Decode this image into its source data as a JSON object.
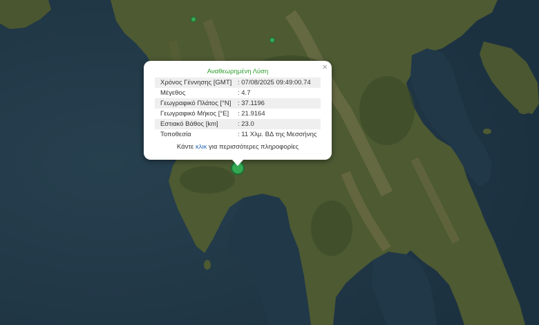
{
  "map": {
    "colors": {
      "sea": "#22394a",
      "land": "#4f5d33",
      "mountain": "#6b6a44",
      "forest": "#3f4f2a"
    }
  },
  "markers": [
    {
      "name": "earthquake-marker-main",
      "color": "#34a853",
      "magnitude": 4.7
    },
    {
      "name": "earthquake-marker-small-1",
      "color": "#34a853"
    },
    {
      "name": "earthquake-marker-small-2",
      "color": "#34a853"
    }
  ],
  "popup": {
    "close": "×",
    "title": "Αναθεωρημένη Λύση",
    "rows": [
      {
        "label": "Χρόνος Γέννησης [GMT]",
        "value": ": 07/08/2025 09:49:00.74"
      },
      {
        "label": "Μέγεθος",
        "value": ": 4.7"
      },
      {
        "label": "Γεωγραφικό Πλάτος [°N]",
        "value": ": 37.1196"
      },
      {
        "label": "Γεωγραφικό Μήκος [°E]",
        "value": ": 21.9164"
      },
      {
        "label": "Εστιακό Βάθος [km]",
        "value": ": 23.0"
      },
      {
        "label": "Τοποθεσία",
        "value": ": 11 Χλμ. ΒΔ της Μεσσήνης"
      }
    ],
    "footer_before": "Κάντε ",
    "footer_link": "κλικ",
    "footer_after": " για περισσότερες πληροφορίες",
    "title_color": "#2e9e2e",
    "link_color": "#2a6ebb"
  }
}
